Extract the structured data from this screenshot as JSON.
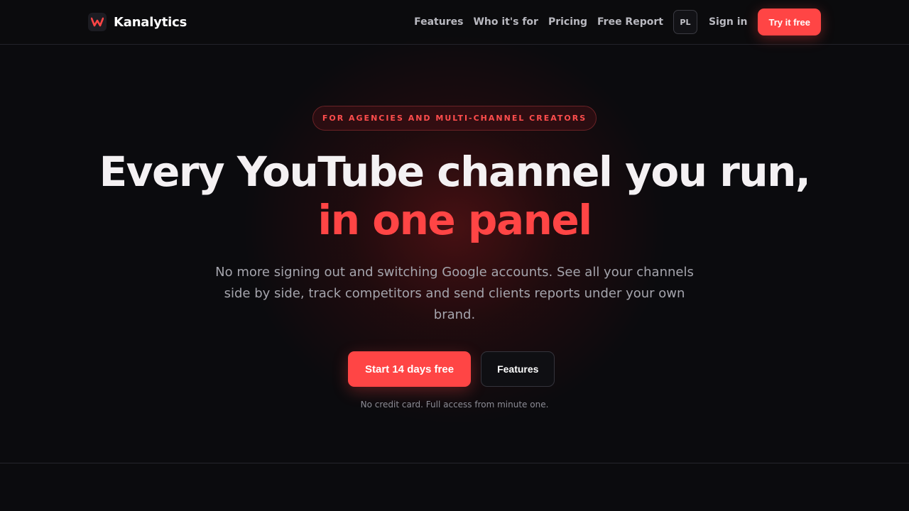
{
  "brand": {
    "name": "Kanalytics",
    "logo_icon": "kanalytics-w-logo-icon"
  },
  "nav": {
    "links": [
      "Features",
      "Who it's for",
      "Pricing",
      "Free Report"
    ],
    "language": "PL",
    "sign_in": "Sign in",
    "try_free": "Try it free"
  },
  "hero": {
    "badge": "FOR AGENCIES AND MULTI-CHANNEL CREATORS",
    "headline_line1": "Every YouTube channel you run,",
    "headline_line2": "in one panel",
    "subtitle": "No more signing out and switching Google accounts. See all your channels side by side, track competitors and send clients reports under your own brand.",
    "primary_cta": "Start 14 days free",
    "secondary_cta": "Features",
    "note": "No credit card. Full access from minute one."
  },
  "colors": {
    "accent": "#ff4545",
    "background": "#0b0b0e",
    "text": "#f4f1f3",
    "muted": "#a5a5ad"
  }
}
